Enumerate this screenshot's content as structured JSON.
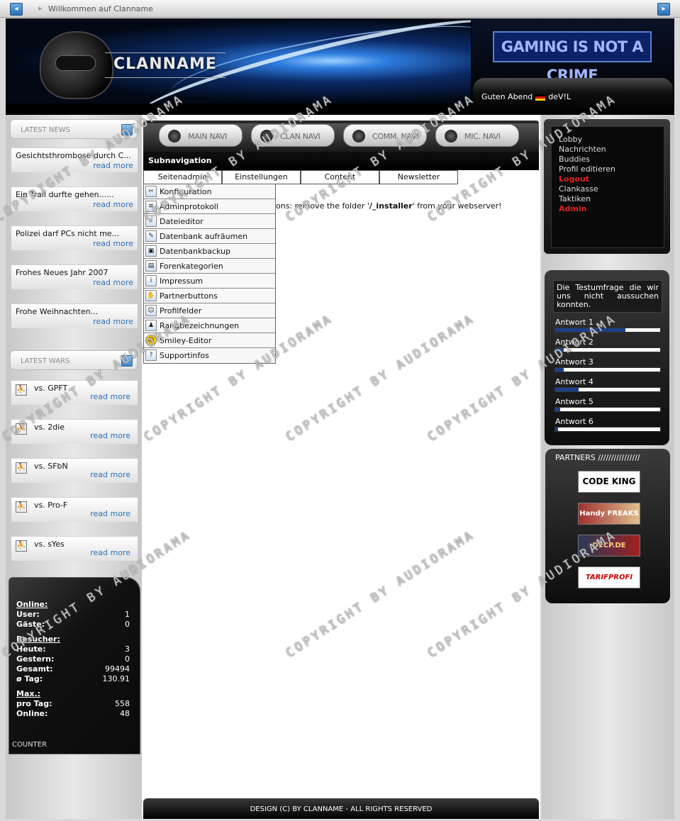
{
  "window": {
    "title": "Willkommen auf Clanname"
  },
  "header": {
    "clan_name": "CLANNAME",
    "slogan": "GAMING IS NOT A CRIME",
    "greeting": "Guten Abend",
    "username": "deV!L"
  },
  "left": {
    "news_title": "LATEST NEWS",
    "news": [
      {
        "title": "Gesichtsthrombose durch C...",
        "more": "read more"
      },
      {
        "title": "Ein Trail durfte gehen......",
        "more": "read more"
      },
      {
        "title": "Polizei darf PCs nicht me...",
        "more": "read more"
      },
      {
        "title": "Frohes Neues Jahr 2007",
        "more": "read more"
      },
      {
        "title": "Frohe Weihnachten...",
        "more": "read more"
      }
    ],
    "wars_title": "LATEST WARS",
    "wars": [
      {
        "title": "vs. GPFT",
        "more": "read more"
      },
      {
        "title": "vs. 2die",
        "more": "read more"
      },
      {
        "title": "vs. SFbN",
        "more": "read more"
      },
      {
        "title": "vs. Pro-F",
        "more": "read more"
      },
      {
        "title": "vs. sYes",
        "more": "read more"
      }
    ],
    "stats": {
      "online_h": "Online:",
      "user_l": "User:",
      "user_v": "1",
      "guests_l": "Gäste:",
      "guests_v": "0",
      "visitors_h": "Besucher:",
      "today_l": "Heute:",
      "today_v": "3",
      "yesterday_l": "Gestern:",
      "yesterday_v": "0",
      "total_l": "Gesamt:",
      "total_v": "99494",
      "avg_l": "ø Tag:",
      "avg_v": "130.91",
      "max_h": "Max.:",
      "perday_l": "pro Tag:",
      "perday_v": "558",
      "maxonline_l": "Online:",
      "maxonline_v": "48",
      "counter": "COUNTER"
    }
  },
  "center": {
    "nav": [
      "MAIN NAVI",
      "CLAN NAVI",
      "COMM. NAVI",
      "MIC. NAVI"
    ],
    "subnav_label": "Subnavigation",
    "tabs": [
      "Seitenadmin",
      "Einstellungen",
      "Content",
      "Newsletter"
    ],
    "menu": [
      "Konfiguration",
      "Adminprotokoll",
      "Dateieditor",
      "Datenbank aufräumen",
      "Datenbankbackup",
      "Forenkategorien",
      "Impressum",
      "Partnerbuttons",
      "Profilfelder",
      "Rangbezeichnungen",
      "Smiley-Editor",
      "Supportinfos"
    ],
    "warning_pre": "ons: remove the folder '",
    "warning_bold": "/_installer",
    "warning_post": "' from your webserver!",
    "footer": "DESIGN (C) BY CLANNAME  -  ALL RIGHTS RESERVED"
  },
  "right": {
    "user_links": [
      "Lobby",
      "Nachrichten",
      "Buddies",
      "Profil editieren",
      "Logout",
      "Clankasse",
      "Taktiken",
      "Admin"
    ],
    "poll_question": "Die Testumfrage die wir uns nicht aussuchen konnten.",
    "poll_answers": [
      {
        "label": "Antwort 1",
        "fraction": 0.67
      },
      {
        "label": "Antwort 2",
        "fraction": 0.08
      },
      {
        "label": "Antwort 3",
        "fraction": 0.08
      },
      {
        "label": "Antwort 4",
        "fraction": 0.22
      },
      {
        "label": "Antwort 5",
        "fraction": 0.05
      },
      {
        "label": "Antwort 6",
        "fraction": 0.03
      }
    ],
    "partners_title": "PARTNERS",
    "partners": [
      "CODE KING",
      "Handy FREAKS",
      "D2CP.DE",
      "TARIFPROFI"
    ]
  },
  "watermark": "COPYRIGHT BY AUDIORAMA",
  "colors": {
    "accent": "#2f6fb5",
    "logout_red": "#e02020",
    "poll_fill": "#1c3f8a"
  }
}
